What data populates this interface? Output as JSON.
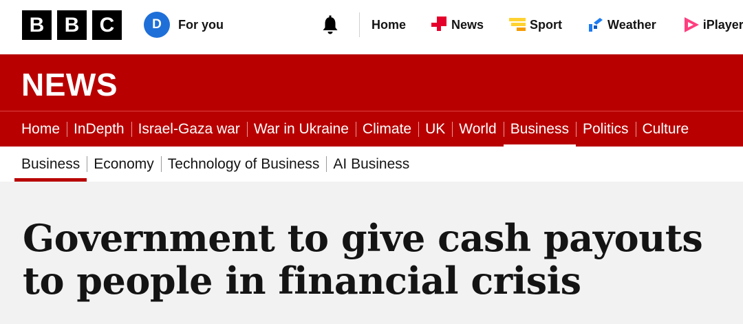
{
  "brand": {
    "letters": [
      "B",
      "B",
      "C"
    ]
  },
  "account": {
    "initial": "D",
    "label": "For you"
  },
  "global_nav": {
    "home": "Home",
    "news": "News",
    "sport": "Sport",
    "weather": "Weather",
    "iplayer": "iPlayer"
  },
  "colors": {
    "news_red": "#b80000",
    "avatar_blue": "#1f6fd8",
    "news_icon_red": "#e4002b",
    "sport_yellow": "#ffd230",
    "weather_blue": "#1d7cf2",
    "iplayer_pink": "#ff3e7f"
  },
  "news_band": {
    "title": "NEWS"
  },
  "section_nav": {
    "items": [
      "Home",
      "InDepth",
      "Israel-Gaza war",
      "War in Ukraine",
      "Climate",
      "UK",
      "World",
      "Business",
      "Politics",
      "Culture"
    ],
    "active": "Business"
  },
  "sub_nav": {
    "items": [
      "Business",
      "Economy",
      "Technology of Business",
      "AI Business"
    ],
    "active": "Business"
  },
  "article": {
    "headline": "Government to give cash payouts to people in financial crisis"
  }
}
